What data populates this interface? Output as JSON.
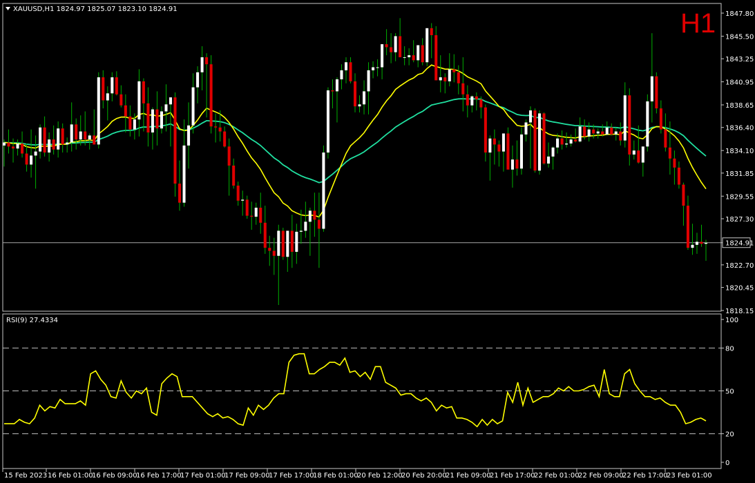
{
  "header": {
    "symbol_line": "XAUUSD,H1  1824.97 1825.07 1823.10 1824.91",
    "timeframe": "H1",
    "rsi_title": "RSI(9) 27.4334"
  },
  "colors": {
    "background": "#000000",
    "bull_candle": "#ffffff",
    "bear_candle": "#e00000",
    "ma_fast": "#ffff00",
    "ma_slow": "#20e0a0",
    "rsi_line": "#ffff00",
    "grid_dash": "#c0c0c0"
  },
  "chart_data": [
    {
      "type": "candlestick",
      "symbol": "XAUUSD",
      "timeframe": "H1",
      "current_price": 1824.91,
      "ylim": [
        1818.15,
        1847.8
      ],
      "yticks": [
        1847.8,
        1845.5,
        1843.25,
        1840.95,
        1838.65,
        1836.4,
        1834.1,
        1831.85,
        1829.55,
        1827.3,
        1824.91,
        1822.7,
        1820.45,
        1818.15
      ],
      "xticks": [
        "15 Feb 2023",
        "16 Feb 01:00",
        "16 Feb 09:00",
        "16 Feb 17:00",
        "17 Feb 01:00",
        "17 Feb 09:00",
        "17 Feb 17:00",
        "18 Feb 01:00",
        "20 Feb 12:00",
        "20 Feb 20:00",
        "21 Feb 09:00",
        "21 Feb 17:00",
        "22 Feb 01:00",
        "22 Feb 09:00",
        "22 Feb 17:00",
        "23 Feb 01:00"
      ],
      "ohlc": [
        [
          1834.6,
          1835.2,
          1832.5,
          1834.9
        ],
        [
          1834.9,
          1836.2,
          1833.8,
          1834.5
        ],
        [
          1834.5,
          1835.3,
          1832.9,
          1834.3
        ],
        [
          1834.3,
          1835.2,
          1833.6,
          1834.8
        ],
        [
          1834.8,
          1836.0,
          1833.4,
          1833.8
        ],
        [
          1833.8,
          1834.8,
          1832.0,
          1832.7
        ],
        [
          1832.7,
          1836.2,
          1831.4,
          1833.6
        ],
        [
          1833.6,
          1835.6,
          1830.3,
          1834.0
        ],
        [
          1834.0,
          1836.7,
          1833.3,
          1836.4
        ],
        [
          1836.4,
          1837.5,
          1833.5,
          1833.9
        ],
        [
          1833.9,
          1835.9,
          1833.0,
          1835.2
        ],
        [
          1835.2,
          1836.6,
          1833.7,
          1834.2
        ],
        [
          1834.2,
          1837.0,
          1833.4,
          1836.3
        ],
        [
          1836.3,
          1836.8,
          1833.9,
          1834.7
        ],
        [
          1834.7,
          1835.4,
          1833.9,
          1834.9
        ],
        [
          1834.9,
          1838.9,
          1834.0,
          1836.7
        ],
        [
          1836.7,
          1837.3,
          1834.2,
          1835.2
        ],
        [
          1835.2,
          1837.6,
          1834.6,
          1836.0
        ],
        [
          1836.0,
          1838.0,
          1834.6,
          1835.2
        ],
        [
          1835.2,
          1835.8,
          1834.2,
          1835.6
        ],
        [
          1835.6,
          1838.2,
          1835.0,
          1834.7
        ],
        [
          1834.7,
          1841.9,
          1834.3,
          1841.4
        ],
        [
          1841.4,
          1842.1,
          1838.3,
          1839.1
        ],
        [
          1839.1,
          1840.5,
          1837.1,
          1839.8
        ],
        [
          1839.8,
          1841.9,
          1839.0,
          1841.4
        ],
        [
          1841.4,
          1842.0,
          1839.6,
          1839.7
        ],
        [
          1839.7,
          1840.6,
          1838.4,
          1838.6
        ],
        [
          1838.6,
          1839.7,
          1835.9,
          1837.5
        ],
        [
          1837.5,
          1838.6,
          1835.5,
          1836.2
        ],
        [
          1836.2,
          1837.8,
          1835.2,
          1837.2
        ],
        [
          1837.2,
          1842.2,
          1835.5,
          1841.0
        ],
        [
          1841.0,
          1841.3,
          1836.0,
          1838.8
        ],
        [
          1838.8,
          1840.4,
          1834.5,
          1835.9
        ],
        [
          1835.9,
          1838.4,
          1834.2,
          1838.2
        ],
        [
          1838.2,
          1840.0,
          1834.6,
          1836.3
        ],
        [
          1836.3,
          1838.5,
          1835.8,
          1838.0
        ],
        [
          1838.0,
          1840.7,
          1836.0,
          1838.7
        ],
        [
          1838.7,
          1839.1,
          1834.5,
          1839.4
        ],
        [
          1839.4,
          1839.9,
          1829.5,
          1830.8
        ],
        [
          1830.8,
          1833.1,
          1828.1,
          1828.9
        ],
        [
          1828.9,
          1837.2,
          1828.5,
          1834.6
        ],
        [
          1834.6,
          1838.9,
          1832.3,
          1836.6
        ],
        [
          1836.6,
          1841.8,
          1835.8,
          1840.4
        ],
        [
          1840.4,
          1842.5,
          1838.8,
          1841.9
        ],
        [
          1841.9,
          1844.5,
          1840.1,
          1843.4
        ],
        [
          1843.4,
          1843.8,
          1837.4,
          1842.7
        ],
        [
          1842.7,
          1843.6,
          1835.8,
          1836.5
        ],
        [
          1836.5,
          1837.8,
          1834.9,
          1836.4
        ],
        [
          1836.4,
          1838.1,
          1835.0,
          1836.0
        ],
        [
          1836.0,
          1836.5,
          1834.4,
          1834.5
        ],
        [
          1834.5,
          1835.3,
          1829.6,
          1832.6
        ],
        [
          1832.6,
          1833.3,
          1830.3,
          1830.6
        ],
        [
          1830.6,
          1831.0,
          1828.6,
          1829.1
        ],
        [
          1829.1,
          1830.1,
          1827.6,
          1829.2
        ],
        [
          1829.2,
          1829.6,
          1827.3,
          1827.6
        ],
        [
          1827.6,
          1829.0,
          1826.2,
          1827.5
        ],
        [
          1827.5,
          1828.9,
          1826.7,
          1828.4
        ],
        [
          1828.4,
          1829.9,
          1825.8,
          1826.9
        ],
        [
          1826.9,
          1828.6,
          1823.8,
          1824.4
        ],
        [
          1824.4,
          1825.6,
          1822.6,
          1824.1
        ],
        [
          1824.1,
          1825.4,
          1821.7,
          1823.6
        ],
        [
          1823.6,
          1826.7,
          1818.7,
          1826.1
        ],
        [
          1826.1,
          1826.4,
          1823.2,
          1823.5
        ],
        [
          1823.5,
          1825.4,
          1822.0,
          1826.1
        ],
        [
          1826.1,
          1827.7,
          1822.4,
          1824.0
        ],
        [
          1824.0,
          1826.8,
          1822.8,
          1826.0
        ],
        [
          1826.0,
          1828.2,
          1824.8,
          1826.1
        ],
        [
          1826.1,
          1829.0,
          1825.4,
          1827.0
        ],
        [
          1827.0,
          1828.4,
          1823.6,
          1828.1
        ],
        [
          1828.1,
          1829.9,
          1825.5,
          1827.2
        ],
        [
          1827.2,
          1829.9,
          1822.4,
          1826.3
        ],
        [
          1826.3,
          1834.6,
          1826.0,
          1833.9
        ],
        [
          1833.9,
          1840.4,
          1833.3,
          1840.1
        ],
        [
          1840.1,
          1841.2,
          1838.3,
          1840.0
        ],
        [
          1840.0,
          1841.4,
          1836.9,
          1841.2
        ],
        [
          1841.2,
          1842.7,
          1840.2,
          1842.1
        ],
        [
          1842.1,
          1843.4,
          1840.8,
          1842.9
        ],
        [
          1842.9,
          1843.4,
          1840.8,
          1841.0
        ],
        [
          1841.0,
          1841.8,
          1837.9,
          1838.5
        ],
        [
          1838.5,
          1839.6,
          1837.9,
          1838.7
        ],
        [
          1838.7,
          1841.1,
          1837.7,
          1840.0
        ],
        [
          1840.0,
          1842.9,
          1837.7,
          1842.1
        ],
        [
          1842.1,
          1843.0,
          1841.3,
          1842.4
        ],
        [
          1842.4,
          1843.2,
          1841.5,
          1842.4
        ],
        [
          1842.4,
          1844.5,
          1841.2,
          1844.7
        ],
        [
          1844.7,
          1846.2,
          1843.6,
          1844.4
        ],
        [
          1844.4,
          1845.8,
          1842.8,
          1843.9
        ],
        [
          1843.9,
          1845.8,
          1843.0,
          1845.5
        ],
        [
          1845.5,
          1847.3,
          1843.8,
          1843.4
        ],
        [
          1843.4,
          1844.5,
          1842.6,
          1843.4
        ],
        [
          1843.4,
          1844.3,
          1842.6,
          1843.6
        ],
        [
          1843.6,
          1845.1,
          1842.9,
          1843.1
        ],
        [
          1843.1,
          1844.6,
          1842.4,
          1844.6
        ],
        [
          1844.6,
          1845.3,
          1842.6,
          1842.9
        ],
        [
          1842.9,
          1845.8,
          1842.5,
          1846.3
        ],
        [
          1846.3,
          1846.8,
          1843.3,
          1845.6
        ],
        [
          1845.6,
          1846.5,
          1842.2,
          1841.1
        ],
        [
          1841.1,
          1843.6,
          1839.9,
          1841.4
        ],
        [
          1841.4,
          1841.8,
          1839.8,
          1841.0
        ],
        [
          1841.0,
          1843.8,
          1840.5,
          1842.2
        ],
        [
          1842.2,
          1843.7,
          1840.9,
          1841.9
        ],
        [
          1841.9,
          1842.6,
          1839.7,
          1840.8
        ],
        [
          1840.8,
          1843.4,
          1838.0,
          1839.7
        ],
        [
          1839.7,
          1840.6,
          1837.4,
          1838.6
        ],
        [
          1838.6,
          1839.6,
          1837.9,
          1839.5
        ],
        [
          1839.5,
          1839.9,
          1838.1,
          1839.2
        ],
        [
          1839.2,
          1839.5,
          1837.3,
          1838.4
        ],
        [
          1838.4,
          1838.7,
          1833.0,
          1833.9
        ],
        [
          1833.9,
          1835.6,
          1831.1,
          1835.3
        ],
        [
          1835.3,
          1836.2,
          1832.7,
          1834.7
        ],
        [
          1834.7,
          1835.1,
          1832.5,
          1834.0
        ],
        [
          1834.0,
          1834.7,
          1832.0,
          1835.8
        ],
        [
          1835.8,
          1836.4,
          1832.5,
          1832.2
        ],
        [
          1832.2,
          1834.6,
          1830.4,
          1833.2
        ],
        [
          1833.2,
          1835.1,
          1831.6,
          1832.3
        ],
        [
          1832.3,
          1836.4,
          1831.7,
          1835.7
        ],
        [
          1835.7,
          1837.2,
          1835.0,
          1836.9
        ],
        [
          1836.9,
          1838.5,
          1832.3,
          1838.1
        ],
        [
          1838.1,
          1838.3,
          1831.9,
          1832.1
        ],
        [
          1832.1,
          1838.1,
          1831.7,
          1837.8
        ],
        [
          1837.8,
          1837.9,
          1832.7,
          1832.8
        ],
        [
          1832.8,
          1834.9,
          1832.4,
          1833.5
        ],
        [
          1833.5,
          1834.5,
          1832.2,
          1834.4
        ],
        [
          1834.4,
          1835.8,
          1833.8,
          1835.3
        ],
        [
          1835.3,
          1836.1,
          1834.2,
          1834.7
        ],
        [
          1834.7,
          1835.9,
          1834.4,
          1834.8
        ],
        [
          1834.8,
          1835.7,
          1834.5,
          1835.2
        ],
        [
          1835.2,
          1836.3,
          1834.9,
          1835.0
        ],
        [
          1835.0,
          1837.4,
          1834.9,
          1836.5
        ],
        [
          1836.5,
          1837.2,
          1835.2,
          1835.5
        ],
        [
          1835.5,
          1836.9,
          1835.0,
          1836.2
        ],
        [
          1836.2,
          1836.7,
          1835.3,
          1835.8
        ],
        [
          1835.8,
          1836.3,
          1835.3,
          1836.0
        ],
        [
          1836.0,
          1836.7,
          1835.5,
          1835.7
        ],
        [
          1835.7,
          1837.0,
          1835.6,
          1836.4
        ],
        [
          1836.4,
          1836.8,
          1835.6,
          1835.7
        ],
        [
          1835.7,
          1836.4,
          1835.1,
          1836.0
        ],
        [
          1836.0,
          1836.9,
          1834.6,
          1835.1
        ],
        [
          1835.1,
          1840.9,
          1834.4,
          1839.6
        ],
        [
          1839.6,
          1840.3,
          1832.6,
          1833.7
        ],
        [
          1833.7,
          1835.1,
          1833.2,
          1834.1
        ],
        [
          1834.1,
          1836.6,
          1832.8,
          1832.9
        ],
        [
          1832.9,
          1834.5,
          1831.5,
          1834.5
        ],
        [
          1834.5,
          1839.7,
          1834.0,
          1839.0
        ],
        [
          1839.0,
          1845.8,
          1836.9,
          1841.5
        ],
        [
          1841.5,
          1841.9,
          1837.8,
          1838.3
        ],
        [
          1838.3,
          1839.1,
          1835.8,
          1836.2
        ],
        [
          1836.2,
          1837.8,
          1834.0,
          1834.4
        ],
        [
          1834.4,
          1837.0,
          1831.7,
          1833.3
        ],
        [
          1833.3,
          1834.1,
          1830.7,
          1832.4
        ],
        [
          1832.4,
          1833.0,
          1830.3,
          1830.7
        ],
        [
          1830.7,
          1830.9,
          1826.6,
          1828.6
        ],
        [
          1828.6,
          1829.6,
          1824.2,
          1824.4
        ],
        [
          1824.4,
          1826.8,
          1823.7,
          1824.7
        ],
        [
          1824.7,
          1825.9,
          1823.8,
          1825.0
        ],
        [
          1825.0,
          1826.7,
          1824.5,
          1824.8
        ],
        [
          1824.8,
          1825.2,
          1823.1,
          1824.9
        ]
      ],
      "overlays": [
        {
          "kind": "moving-average",
          "color": "yellow"
        },
        {
          "kind": "moving-average",
          "color": "teal"
        }
      ]
    },
    {
      "type": "line",
      "indicator": "RSI(9)",
      "current_value": 27.4334,
      "ylim": [
        0,
        100
      ],
      "yticks": [
        100,
        80,
        50,
        20,
        0
      ],
      "levels": [
        80,
        50,
        20
      ],
      "values": [
        27,
        27,
        27,
        30,
        28,
        27,
        31,
        40,
        36,
        39,
        38,
        44,
        41,
        41,
        41,
        43,
        40,
        62,
        64,
        58,
        54,
        46,
        45,
        57,
        49,
        45,
        50,
        48,
        52,
        35,
        33,
        55,
        59,
        62,
        60,
        46,
        46,
        46,
        42,
        38,
        34,
        32,
        34,
        31,
        32,
        30,
        27,
        26,
        38,
        33,
        40,
        37,
        40,
        45,
        48,
        48,
        70,
        75,
        76,
        76,
        62,
        62,
        65,
        67,
        70,
        70,
        68,
        73,
        63,
        64,
        60,
        63,
        58,
        67,
        67,
        56,
        54,
        52,
        47,
        48,
        48,
        45,
        43,
        45,
        42,
        36,
        40,
        38,
        39,
        31,
        31,
        30,
        28,
        25,
        30,
        26,
        30,
        27,
        29,
        49,
        42,
        56,
        40,
        52,
        42,
        44,
        46,
        46,
        48,
        52,
        50,
        53,
        50,
        50,
        51,
        53,
        54,
        46,
        65,
        48,
        46,
        46,
        62,
        65,
        55,
        50,
        46,
        46,
        44,
        45,
        42,
        40,
        40,
        35,
        27,
        28,
        30,
        31,
        29
      ]
    }
  ]
}
